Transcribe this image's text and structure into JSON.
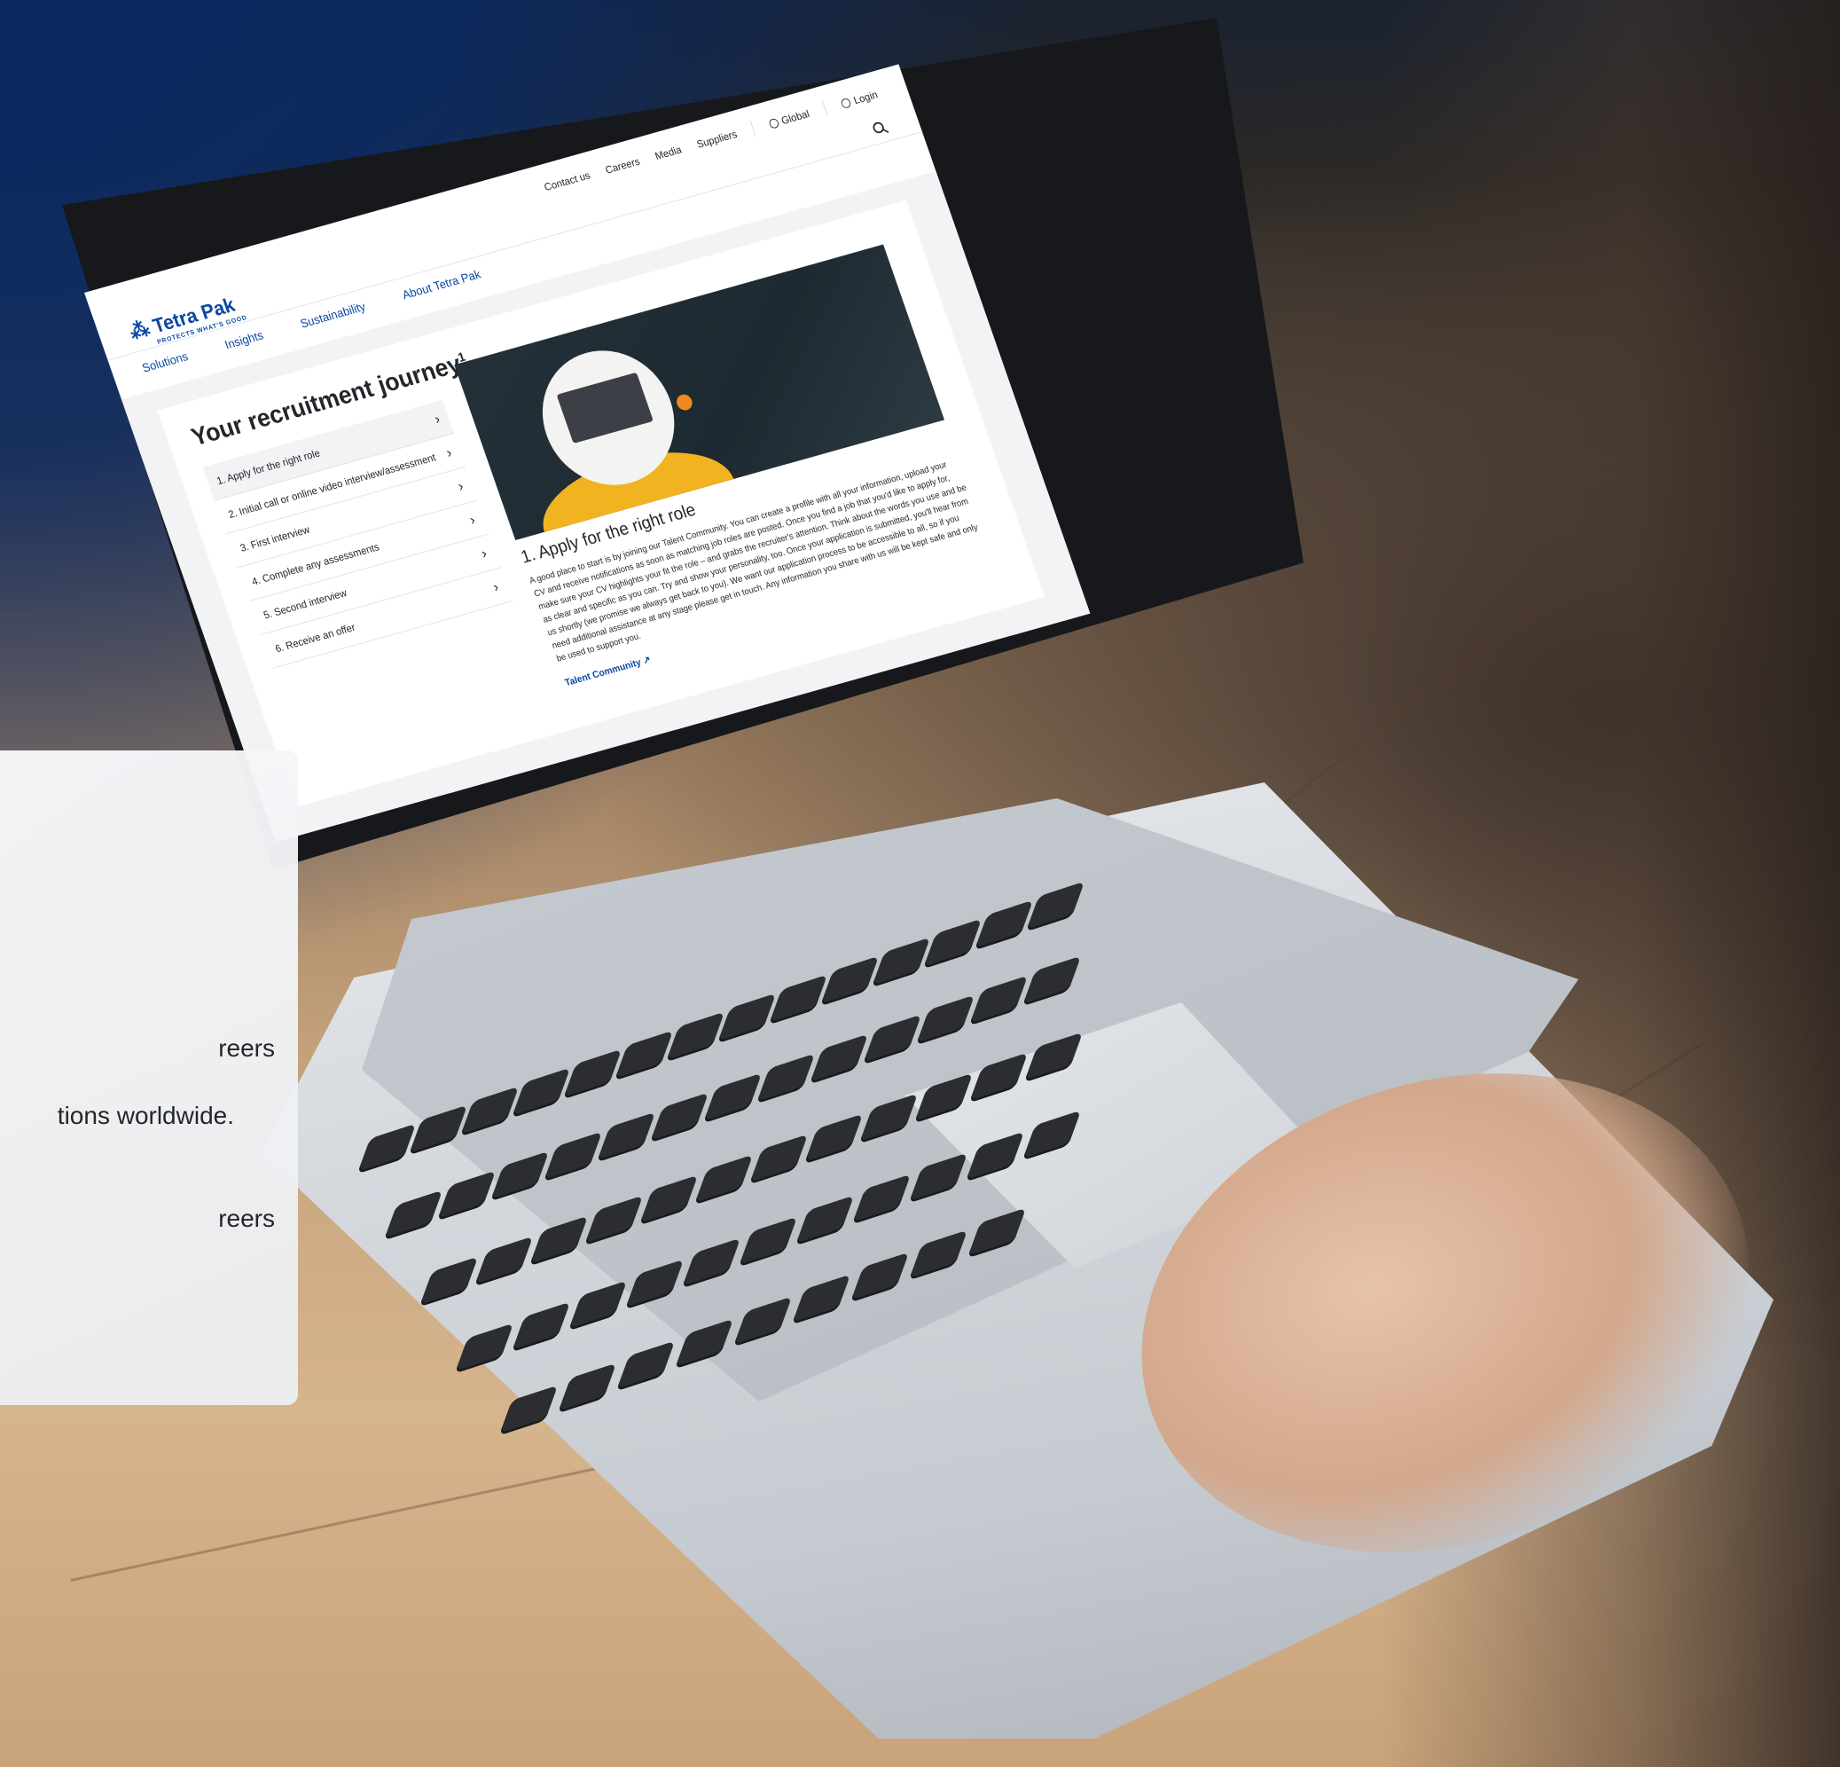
{
  "website": {
    "logo_name": "Tetra Pak",
    "logo_tagline": "PROTECTS WHAT'S GOOD",
    "utility_nav": [
      "Contact us",
      "Careers",
      "Media",
      "Suppliers"
    ],
    "region": "Global",
    "login": "Login",
    "main_nav": [
      "Solutions",
      "Insights",
      "Sustainability",
      "About Tetra Pak"
    ],
    "page_title": "Your recruitment journey",
    "page_title_sup": "1",
    "steps": [
      "1. Apply for the right role",
      "2. Initial call or online video interview/assessment",
      "3. First interview",
      "4. Complete any assessments",
      "5. Second interview",
      "6. Receive an offer"
    ],
    "detail": {
      "title": "1. Apply for the right role",
      "body": "A good place to start is by joining our Talent Community. You can create a profile with all your information, upload your CV and receive notifications as soon as matching job roles are posted. Once you find a job that you'd like to apply for, make sure your CV highlights your fit the role – and grabs the recruiter's attention. Think about the words you use and be as clear and specific as you can. Try and show your personality, too. Once your application is submitted, you'll hear from us shortly (we promise we always get back to you). We want our application process to be accessible to all, so if you need additional assistance at any stage please get in touch. Any information you share with us will be kept safe and only be used to support you.",
      "link": "Talent Community"
    }
  },
  "overlay": {
    "line1": "reers",
    "line2": "tions worldwide.",
    "line3": "reers"
  },
  "colors": {
    "brand_blue": "#0b47a1",
    "text": "#23262b"
  }
}
